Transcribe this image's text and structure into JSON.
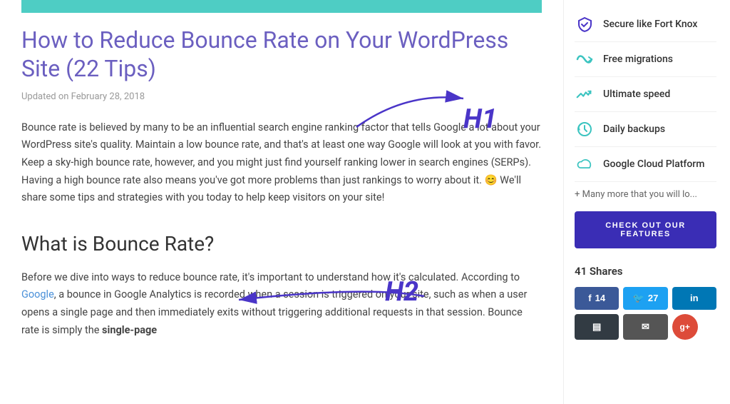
{
  "topbar": {
    "color": "#4ecdc4"
  },
  "article": {
    "title": "How to Reduce Bounce Rate on Your WordPress Site (22 Tips)",
    "updated": "Updated on February 28, 2018",
    "intro": "Bounce rate is believed by many to be an influential search engine ranking factor that tells Google a lot about your WordPress site's quality. Maintain a low bounce rate, and that's at least one way Google will look at you with favor. Keep a sky-high bounce rate, however, and you might just find yourself ranking lower in search engines (SERPs). Having a high bounce rate also means you've got more problems than just rankings to worry about it. 😊 We'll share some tips and strategies with you today to help keep visitors on your site!",
    "h2_title": "What is Bounce Rate?",
    "h2_body_1": "Before we dive into ways to reduce bounce rate, it's important to understand how it's calculated. According to ",
    "h2_body_link": "Google",
    "h2_body_2": ", a bounce in Google Analytics is recorded when a session is triggered on your site, such as when a user opens a single page and then immediately exits without triggering additional requests in that session. Bounce rate is simply the ",
    "h2_body_3": "single-page"
  },
  "annotations": {
    "h1_label": "H1",
    "h2_label": "H2"
  },
  "sidebar": {
    "features": [
      {
        "icon": "shield",
        "label": "Secure like Fort Knox"
      },
      {
        "icon": "migrate",
        "label": "Free migrations"
      },
      {
        "icon": "speed",
        "label": "Ultimate speed"
      },
      {
        "icon": "backup",
        "label": "Daily backups"
      },
      {
        "icon": "cloud",
        "label": "Google Cloud Platform"
      }
    ],
    "more_text": "+ Many more that you will lo...",
    "cta_label": "CHECK OUT OUR FEATURES",
    "shares_title": "41 Shares",
    "share_buttons": [
      {
        "platform": "facebook",
        "count": "14"
      },
      {
        "platform": "twitter",
        "count": "27"
      },
      {
        "platform": "linkedin",
        "count": ""
      },
      {
        "platform": "buffer",
        "count": ""
      },
      {
        "platform": "email",
        "count": ""
      }
    ]
  }
}
